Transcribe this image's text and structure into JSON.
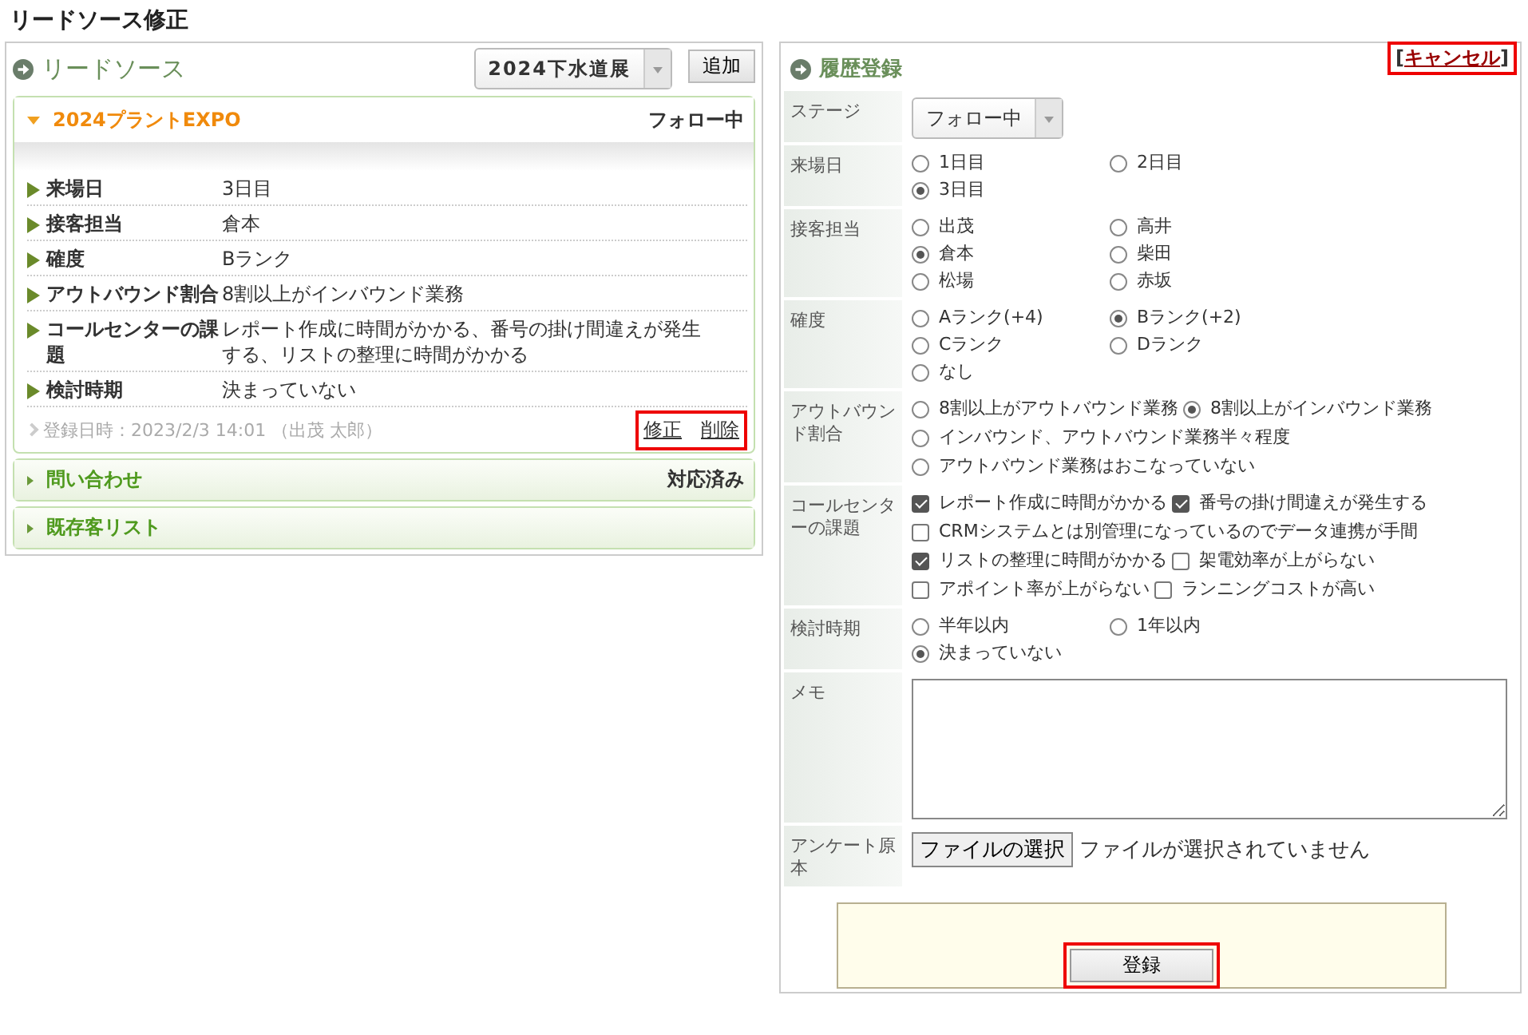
{
  "page_title": "リードソース修正",
  "lead_source": {
    "title": "リードソース",
    "select": "2024下水道展",
    "add_button": "追加",
    "sections": [
      {
        "title": "2024プラントEXPO",
        "status": "フォロー中",
        "expanded": true,
        "details": [
          {
            "label": "来場日",
            "value": "3日目"
          },
          {
            "label": "接客担当",
            "value": "倉本"
          },
          {
            "label": "確度",
            "value": "Bランク"
          },
          {
            "label": "アウトバウンド割合",
            "value": "8割以上がインバウンド業務"
          },
          {
            "label": "コールセンターの課題",
            "value": "レポート作成に時間がかかる、番号の掛け間違えが発生する、リストの整理に時間がかかる"
          },
          {
            "label": "検討時期",
            "value": "決まっていない"
          }
        ],
        "footer": "登録日時：2023/2/3 14:01 （出茂 太郎）",
        "actions_highlighted": true,
        "actions": [
          "修正",
          "削除"
        ]
      },
      {
        "title": "問い合わせ",
        "status": "対応済み",
        "expanded": false
      },
      {
        "title": "既存客リスト",
        "expanded": false
      }
    ]
  },
  "history": {
    "title": "履歴登録",
    "cancel": {
      "prefix": "[",
      "label": "キャンセル",
      "suffix": "]",
      "highlighted": true
    },
    "rows": [
      {
        "kind": "select",
        "label": "ステージ",
        "value": "フォロー中"
      },
      {
        "kind": "radio",
        "label": "来場日",
        "options": [
          {
            "label": "1日目",
            "selected": false
          },
          {
            "label": "2日目",
            "selected": false
          },
          {
            "label": "3日目",
            "selected": true
          }
        ]
      },
      {
        "kind": "radio",
        "label": "接客担当",
        "options": [
          {
            "label": "出茂",
            "selected": false
          },
          {
            "label": "高井",
            "selected": false
          },
          {
            "label": "倉本",
            "selected": true
          },
          {
            "label": "柴田",
            "selected": false
          },
          {
            "label": "松場",
            "selected": false
          },
          {
            "label": "赤坂",
            "selected": false
          }
        ]
      },
      {
        "kind": "radio",
        "label": "確度",
        "options": [
          {
            "label": "Aランク(+4)",
            "selected": false
          },
          {
            "label": "Bランク(+2)",
            "selected": true
          },
          {
            "label": "Cランク",
            "selected": false
          },
          {
            "label": "Dランク",
            "selected": false
          },
          {
            "label": "なし",
            "selected": false
          }
        ]
      },
      {
        "kind": "radio-inline",
        "label": "アウトバウンド割合",
        "options": [
          {
            "label": "8割以上がアウトバウンド業務",
            "selected": false
          },
          {
            "label": "8割以上がインバウンド業務",
            "selected": true
          },
          {
            "label": "インバウンド、アウトバウンド業務半々程度",
            "selected": false
          },
          {
            "label": "アウトバウンド業務はおこなっていない",
            "selected": false
          }
        ]
      },
      {
        "kind": "checkbox",
        "label": "コールセンターの課題",
        "options": [
          {
            "label": "レポート作成に時間がかかる",
            "checked": true
          },
          {
            "label": "番号の掛け間違えが発生する",
            "checked": true
          },
          {
            "label": "CRMシステムとは別管理になっているのでデータ連携が手間",
            "checked": false
          },
          {
            "label": "リストの整理に時間がかかる",
            "checked": true
          },
          {
            "label": "架電効率が上がらない",
            "checked": false
          },
          {
            "label": "アポイント率が上がらない",
            "checked": false
          },
          {
            "label": "ランニングコストが高い",
            "checked": false
          }
        ]
      },
      {
        "kind": "radio",
        "label": "検討時期",
        "options": [
          {
            "label": "半年以内",
            "selected": false
          },
          {
            "label": "1年以内",
            "selected": false
          },
          {
            "label": "決まっていない",
            "selected": true
          }
        ]
      },
      {
        "kind": "textarea",
        "label": "メモ"
      },
      {
        "kind": "file",
        "label": "アンケート原本",
        "button": "ファイルの選択",
        "status": "ファイルが選択されていません"
      }
    ],
    "submit": {
      "label": "登録",
      "highlighted": true
    }
  }
}
